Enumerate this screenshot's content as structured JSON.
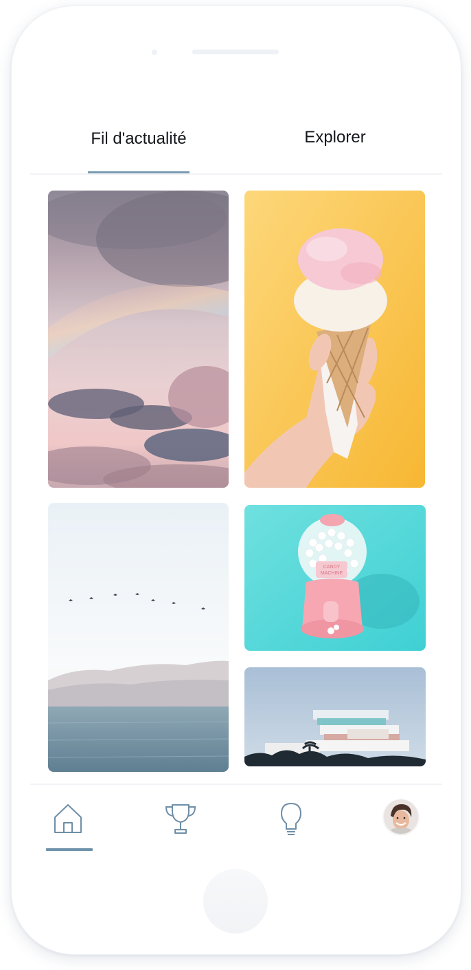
{
  "tabs": {
    "feed_label": "Fil d'actualité",
    "explore_label": "Explorer",
    "active": "feed"
  },
  "feed": {
    "cards": [
      {
        "subject": "sky-with-pastel-clouds-and-rainbow"
      },
      {
        "subject": "hand-holding-ice-cream-cone"
      },
      {
        "subject": "birds-over-sea-and-mountains"
      },
      {
        "subject": "pink-gumball-machine"
      },
      {
        "subject": "white-building-under-blue-sky"
      }
    ],
    "gumball_label_line1": "CANDY",
    "gumball_label_line2": "MACHINE"
  },
  "bottom_nav": {
    "items": [
      "home-icon",
      "trophy-icon",
      "lightbulb-icon",
      "profile-avatar"
    ],
    "active": "home-icon"
  },
  "colors": {
    "accent": "#7a9bb4",
    "icon_stroke": "#6f8ea6",
    "text": "#14171c"
  }
}
